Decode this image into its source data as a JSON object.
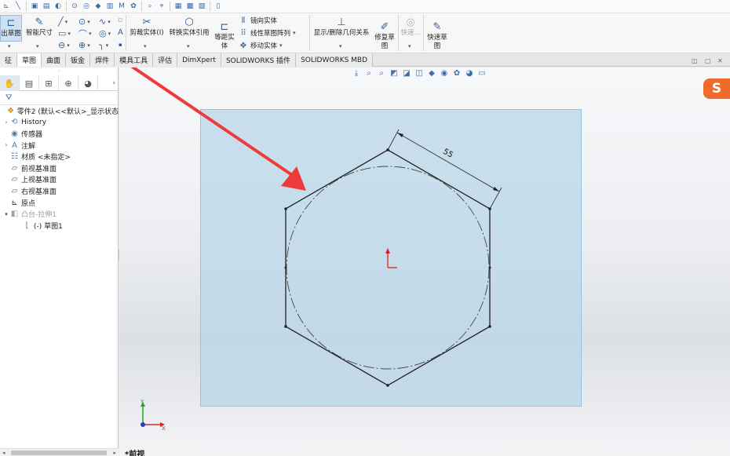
{
  "ribbon": {
    "exit_sketch": "出草图",
    "smart_dimension": "智能尺寸",
    "trim_entities": "剪裁实体(I)",
    "convert_entities": "转换实体引用",
    "offset_entities_line1": "等距实",
    "offset_entities_line2": "体",
    "mirror_entities": "镜向实体",
    "linear_pattern": "线性草图阵列",
    "move_entities": "移动实体",
    "display_relations": "显示/删除几何关系",
    "repair_sketch_line1": "修复草",
    "repair_sketch_line2": "图",
    "quick_snaps": "快速...",
    "rapid_sketch_line1": "快速草",
    "rapid_sketch_line2": "图"
  },
  "tabs": [
    {
      "label": "征",
      "active": false
    },
    {
      "label": "草图",
      "active": true
    },
    {
      "label": "曲面",
      "active": false
    },
    {
      "label": "钣金",
      "active": false
    },
    {
      "label": "焊件",
      "active": false
    },
    {
      "label": "模具工具",
      "active": false
    },
    {
      "label": "评估",
      "active": false
    },
    {
      "label": "DimXpert",
      "active": false
    },
    {
      "label": "SOLIDWORKS 插件",
      "active": false
    },
    {
      "label": "SOLIDWORKS MBD",
      "active": false
    }
  ],
  "tree": {
    "root": "零件2 (默认<<默认>_显示状态",
    "items": [
      {
        "label": "History",
        "icon": "history-icon",
        "expandable": true
      },
      {
        "label": "传感器",
        "icon": "sensor-icon",
        "expandable": false
      },
      {
        "label": "注解",
        "icon": "annotation-icon",
        "expandable": true
      },
      {
        "label": "材质 <未指定>",
        "icon": "material-icon",
        "expandable": false
      },
      {
        "label": "前视基准面",
        "icon": "plane-icon",
        "expandable": false
      },
      {
        "label": "上视基准面",
        "icon": "plane-icon",
        "expandable": false
      },
      {
        "label": "右视基准面",
        "icon": "plane-icon",
        "expandable": false
      },
      {
        "label": "原点",
        "icon": "origin-icon",
        "expandable": false
      },
      {
        "label": "凸台-拉伸1",
        "icon": "extrude-icon",
        "expandable": true
      },
      {
        "label": "(-) 草图1",
        "icon": "sketch-icon",
        "expandable": false
      }
    ]
  },
  "graphics": {
    "dimension_value": "55",
    "view_name": "*前视",
    "axis_y": "Y",
    "axis_x": "X",
    "logo_text": "S"
  },
  "colors": {
    "accent": "#2c5f9a",
    "plane_fill": "#b7d6e8",
    "arrow_red": "#ee3a3a",
    "sketch_line": "#222222"
  }
}
